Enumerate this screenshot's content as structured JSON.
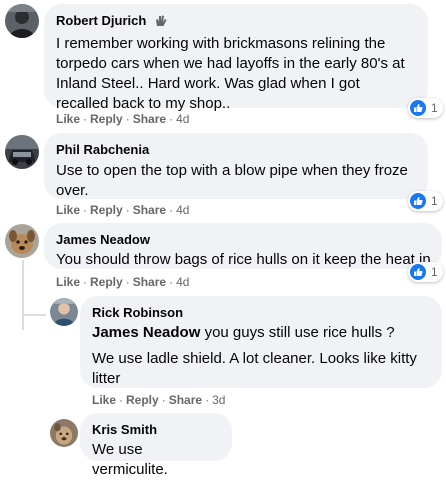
{
  "comments": [
    {
      "author": "Robert Djurich",
      "avatar_icon": "person-avatar-icon",
      "badge_icon": "waving-hand-icon",
      "text": "I remember working with brickmasons relining the torpedo cars when we had layoffs in the early 80's at Inland Steel.. Hard work. Was glad when I got recalled back to my shop..",
      "like_label": "Like",
      "reply_label": "Reply",
      "share_label": "Share",
      "time": "4d",
      "reaction_count": "1"
    },
    {
      "author": "Phil Rabchenia",
      "avatar_icon": "car-avatar-icon",
      "text": "Use to open the top with a blow pipe when they froze over.",
      "like_label": "Like",
      "reply_label": "Reply",
      "share_label": "Share",
      "time": "4d",
      "reaction_count": "1"
    },
    {
      "author": "James Neadow",
      "avatar_icon": "dog-avatar-icon",
      "text": "You should throw bags of rice hulls on it keep the heat in",
      "like_label": "Like",
      "reply_label": "Reply",
      "share_label": "Share",
      "time": "4d",
      "reaction_count": "1"
    }
  ],
  "replies": [
    {
      "author": "Rick Robinson",
      "avatar_icon": "person-avatar-icon",
      "mention": "James Neadow",
      "text_line1": "you guys still use rice hulls ?",
      "text_line2": "We use ladle shield. A lot cleaner. Looks like kitty litter",
      "like_label": "Like",
      "reply_label": "Reply",
      "share_label": "Share",
      "time": "3d"
    },
    {
      "author": "Kris Smith",
      "avatar_icon": "pet-avatar-icon",
      "text": "We use vermiculite."
    }
  ],
  "colors": {
    "bubble": "#f0f2f5",
    "like_blue": "#1877f2",
    "meta_gray": "#65676b"
  }
}
